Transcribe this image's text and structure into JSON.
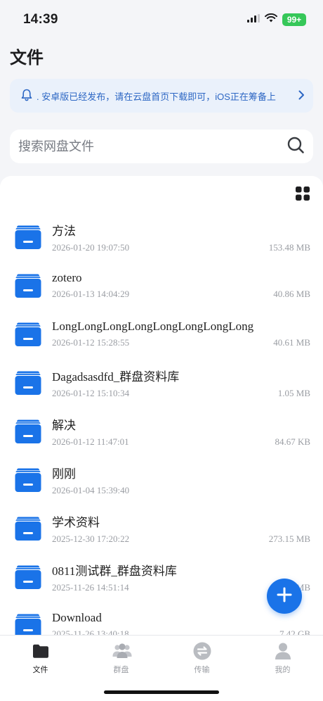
{
  "status_bar": {
    "time": "14:39",
    "battery": "99+"
  },
  "header": {
    "title": "文件"
  },
  "notice": {
    "text": ". 安卓版已经发布，请在云盘首页下载即可，iOS正在筹备上"
  },
  "search": {
    "placeholder": "搜索网盘文件"
  },
  "files": [
    {
      "name": "方法",
      "date": "2026-01-20 19:07:50",
      "size": "153.48 MB"
    },
    {
      "name": "zotero",
      "date": "2026-01-13 14:04:29",
      "size": "40.86 MB"
    },
    {
      "name": "LongLongLongLongLongLongLongLong",
      "date": "2026-01-12 15:28:55",
      "size": "40.61 MB"
    },
    {
      "name": "Dagadsasdfd_群盘资料库",
      "date": "2026-01-12 15:10:34",
      "size": "1.05 MB"
    },
    {
      "name": "解决",
      "date": "2026-01-12 11:47:01",
      "size": "84.67 KB"
    },
    {
      "name": "刚刚",
      "date": "2026-01-04 15:39:40",
      "size": ""
    },
    {
      "name": "学术资料",
      "date": "2025-12-30 17:20:22",
      "size": "273.15 MB"
    },
    {
      "name": "0811测试群_群盘资料库",
      "date": "2025-11-26 14:51:14",
      "size": "MB"
    },
    {
      "name": "Download",
      "date": "2025-11-26 13:40:18",
      "size": "7.42 GB"
    }
  ],
  "tabs": [
    {
      "label": "文件",
      "icon": "folder-icon"
    },
    {
      "label": "群盘",
      "icon": "group-icon"
    },
    {
      "label": "传输",
      "icon": "transfer-icon"
    },
    {
      "label": "我的",
      "icon": "profile-icon"
    }
  ],
  "colors": {
    "accent": "#1a73e8",
    "notice_bg": "#eaf1fb",
    "notice_text": "#2d67c4",
    "battery": "#36c759"
  }
}
